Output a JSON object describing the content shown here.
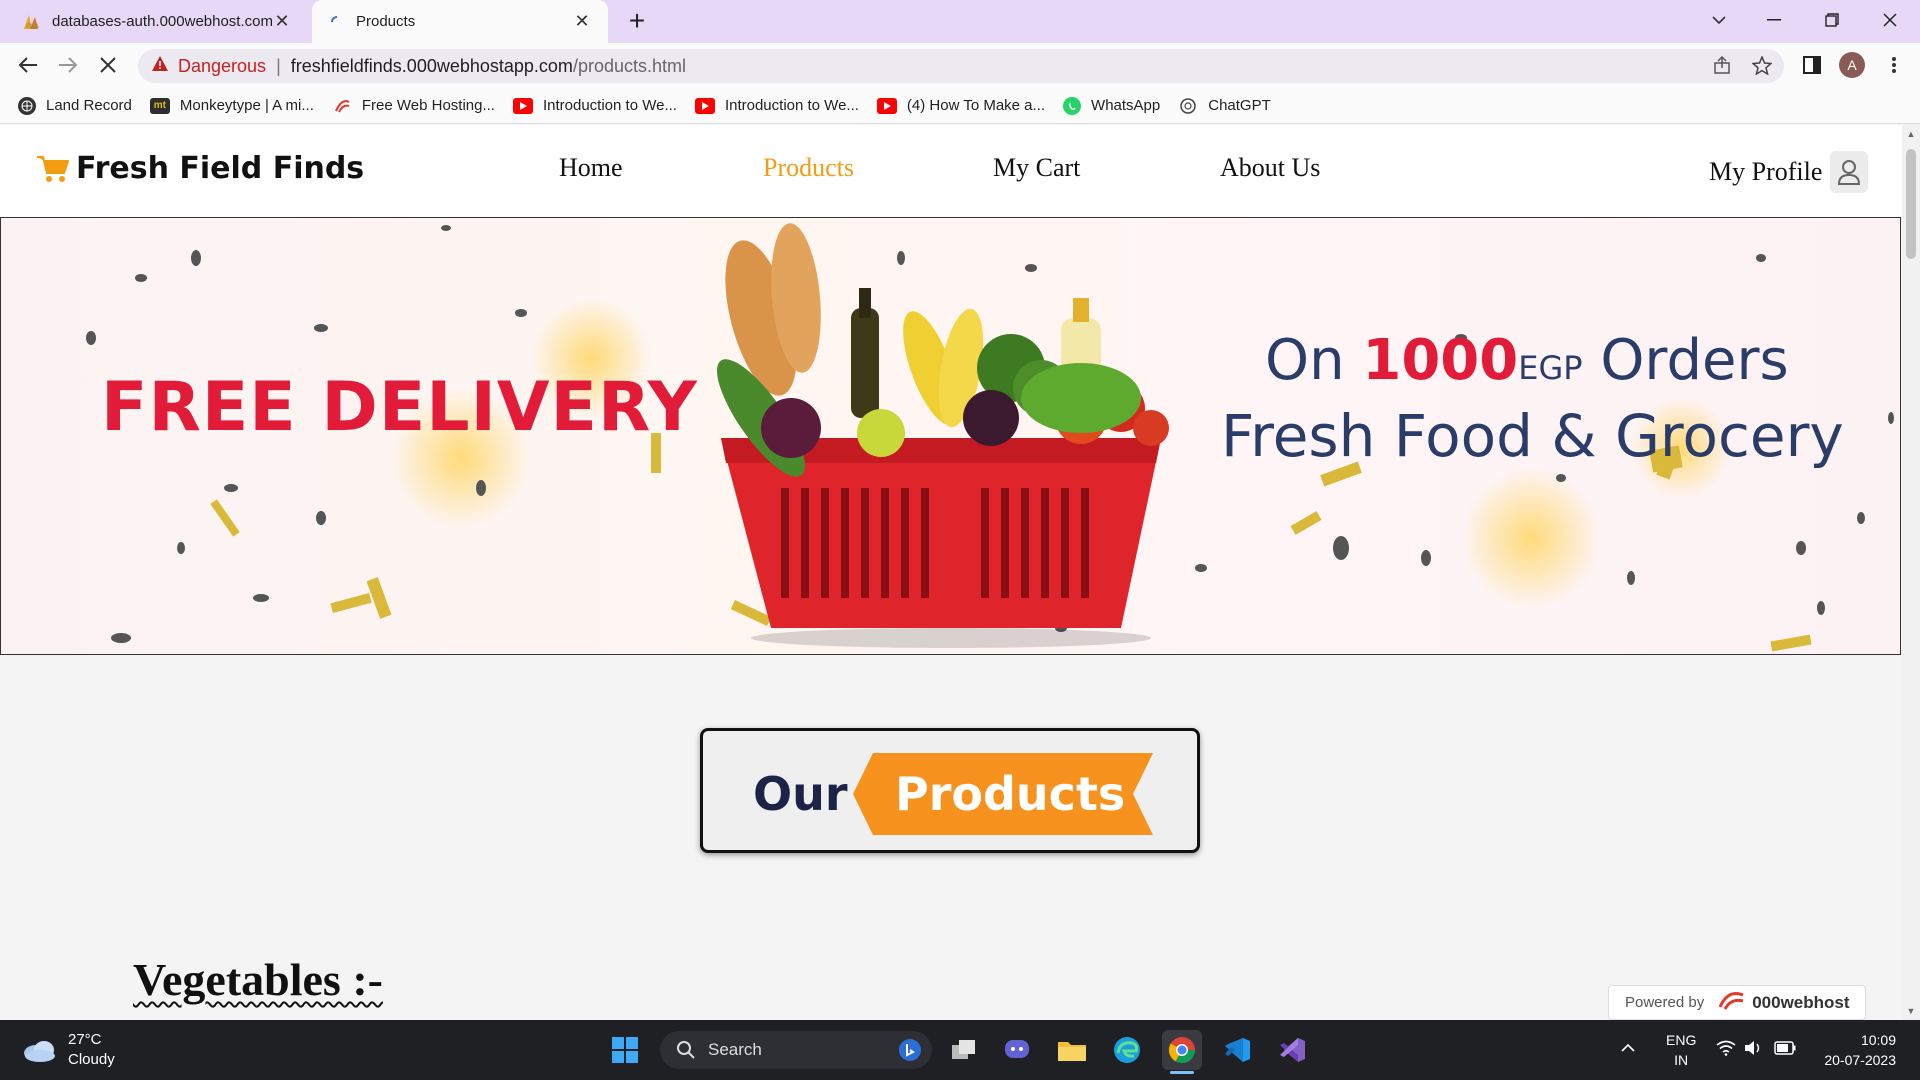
{
  "browser": {
    "tabs": [
      {
        "title": "databases-auth.000webhost.com",
        "active": false
      },
      {
        "title": "Products",
        "active": true
      }
    ],
    "new_tab": "+",
    "security_label": "Dangerous",
    "url_host": "freshfieldfinds.000webhostapp.com",
    "url_path": "/products.html",
    "profile_initial": "A",
    "bookmarks": [
      {
        "label": "Land Record",
        "icon": "globe-icon"
      },
      {
        "label": "Monkeytype | A mi...",
        "icon": "monkeytype-icon"
      },
      {
        "label": "Free Web Hosting...",
        "icon": "000webhost-icon"
      },
      {
        "label": "Introduction to We...",
        "icon": "youtube-icon"
      },
      {
        "label": "Introduction to We...",
        "icon": "youtube-icon"
      },
      {
        "label": "(4) How To Make a...",
        "icon": "youtube-icon"
      },
      {
        "label": "WhatsApp",
        "icon": "whatsapp-icon"
      },
      {
        "label": "ChatGPT",
        "icon": "chatgpt-icon"
      }
    ]
  },
  "site": {
    "brand": "Fresh Field Finds",
    "nav": [
      {
        "label": "Home",
        "active": false
      },
      {
        "label": "Products",
        "active": true
      },
      {
        "label": "My Cart",
        "active": false
      },
      {
        "label": "About Us",
        "active": false
      }
    ],
    "profile_label": "My Profile",
    "banner": {
      "headline": "FREE DELIVERY",
      "line1_prefix": "On ",
      "line1_amount": "1000",
      "line1_currency": "EGP",
      "line1_suffix": " Orders",
      "line2": "Fresh Food & Grocery"
    },
    "section_badge": {
      "word1": "Our",
      "word2": "Products"
    },
    "section_title": "Vegetables :-",
    "powered_by": {
      "label": "Powered by",
      "brand": "000webhost"
    }
  },
  "taskbar": {
    "weather_temp": "27°C",
    "weather_desc": "Cloudy",
    "search_label": "Search",
    "lang_line1": "ENG",
    "lang_line2": "IN",
    "time": "10:09",
    "date": "20-07-2023"
  },
  "colors": {
    "accent_orange": "#f39c12",
    "banner_red": "#e21c38",
    "banner_navy": "#2a3d6a",
    "tab_strip": "#e7d8f7"
  }
}
